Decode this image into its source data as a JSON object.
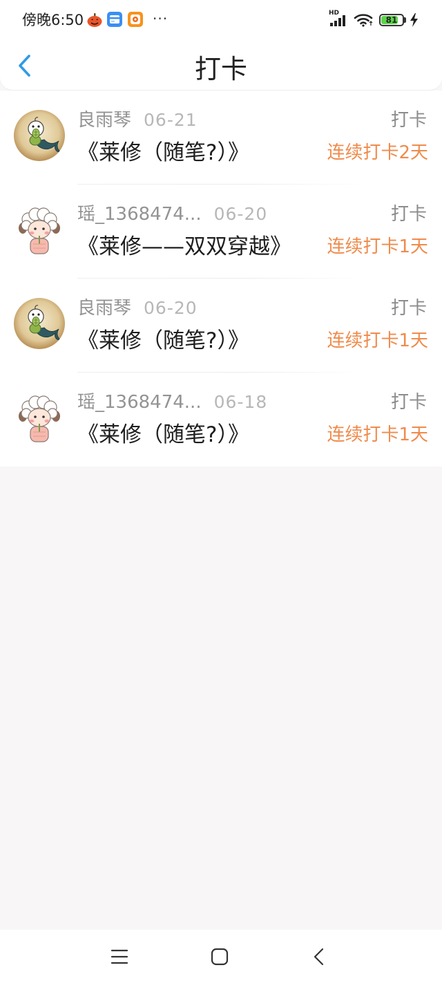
{
  "status_bar": {
    "time": "傍晚6:50",
    "notification_icons": [
      "pumpkin-icon",
      "card-app-icon",
      "orange-app-icon"
    ],
    "more": "···",
    "network_label": "HD",
    "battery_level": "81",
    "charging_icon": "bolt-icon"
  },
  "header": {
    "back_icon": "chevron-left-icon",
    "title": "打卡"
  },
  "colors": {
    "accent_blue": "#2e9be6",
    "streak_orange": "#ef8b4c",
    "battery_green": "#5fd34d",
    "page_background": "#f8f6f7"
  },
  "checkins": [
    {
      "avatar": "mermaid-avatar",
      "name": "良雨琴",
      "date": "06-21",
      "action": "打卡",
      "title": "《莱修（随笔?）》",
      "streak": "连续打卡2天"
    },
    {
      "avatar": "sheep-avatar",
      "name": "瑶_1368474...",
      "date": "06-20",
      "action": "打卡",
      "title": "《莱修——双双穿越》",
      "streak": "连续打卡1天"
    },
    {
      "avatar": "mermaid-avatar",
      "name": "良雨琴",
      "date": "06-20",
      "action": "打卡",
      "title": "《莱修（随笔?）》",
      "streak": "连续打卡1天"
    },
    {
      "avatar": "sheep-avatar",
      "name": "瑶_1368474...",
      "date": "06-18",
      "action": "打卡",
      "title": "《莱修（随笔?）》",
      "streak": "连续打卡1天"
    }
  ],
  "nav_bar": {
    "buttons": [
      "menu-icon",
      "home-square-icon",
      "back-chevron-icon"
    ]
  }
}
